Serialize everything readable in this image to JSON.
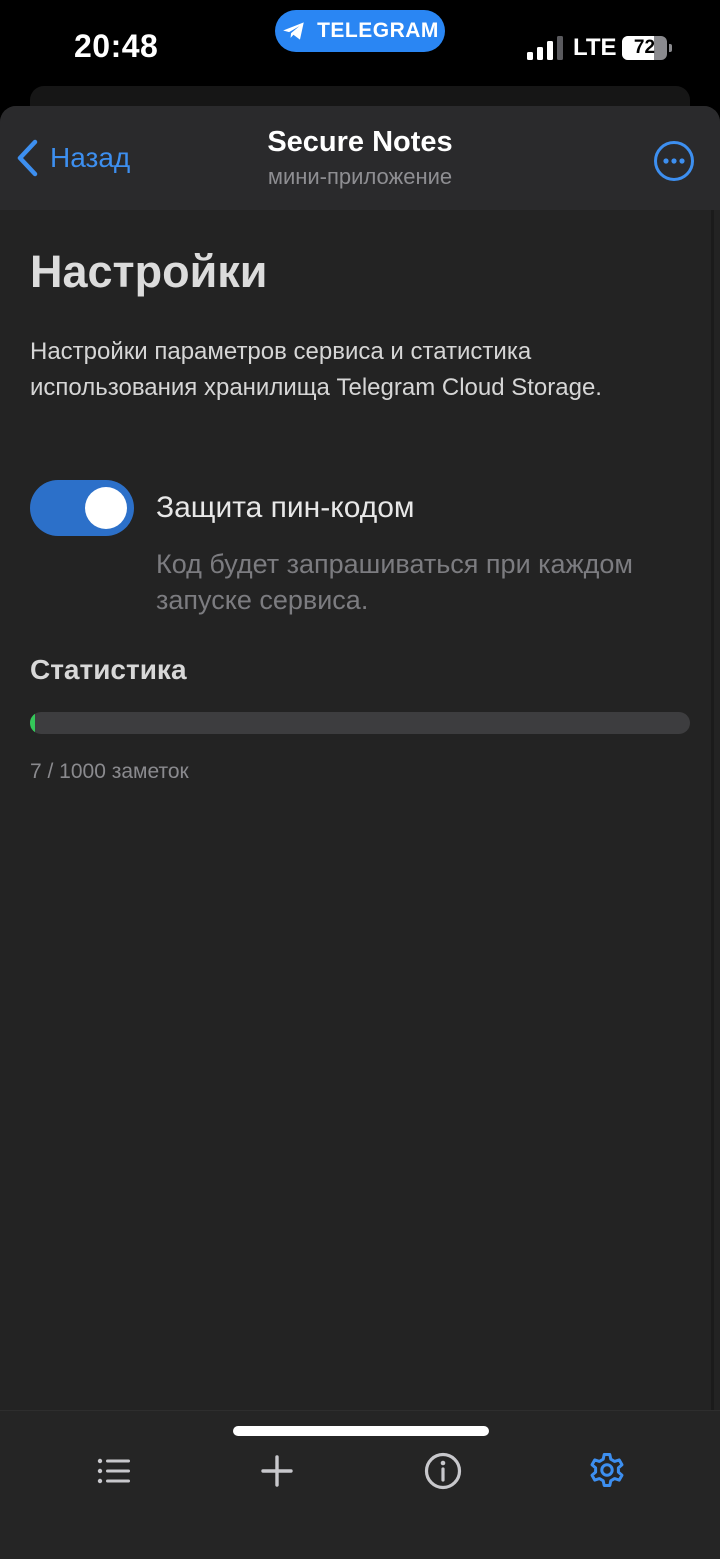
{
  "status_bar": {
    "time": "20:48",
    "pill_label": "TELEGRAM",
    "network": "LTE",
    "battery_percent": "72",
    "battery_level": 0.72
  },
  "nav": {
    "back_label": "Назад",
    "title": "Secure Notes",
    "subtitle": "мини-приложение",
    "more_icon": "ellipsis-circle-icon"
  },
  "settings": {
    "title": "Настройки",
    "description": "Настройки параметров сервиса и статистика использования хранилища Telegram Cloud Storage.",
    "pin_toggle": {
      "label": "Защита пин-кодом",
      "hint": "Код будет запрашиваться при каждом запуске сервиса.",
      "enabled": true
    },
    "stats": {
      "title": "Статистика",
      "used": 7,
      "limit": 1000,
      "caption": "7 / 1000 заметок"
    }
  },
  "tabs": [
    {
      "name": "list",
      "icon": "list-icon",
      "active": false
    },
    {
      "name": "add",
      "icon": "plus-icon",
      "active": false
    },
    {
      "name": "info",
      "icon": "info-circle-icon",
      "active": false
    },
    {
      "name": "settings",
      "icon": "gear-icon",
      "active": true
    }
  ],
  "colors": {
    "accent": "#3d8ff0",
    "toggle_on": "#2c70c9",
    "progress": "#34c759",
    "tab_inactive": "#c8c8cc",
    "background": "#232323"
  }
}
